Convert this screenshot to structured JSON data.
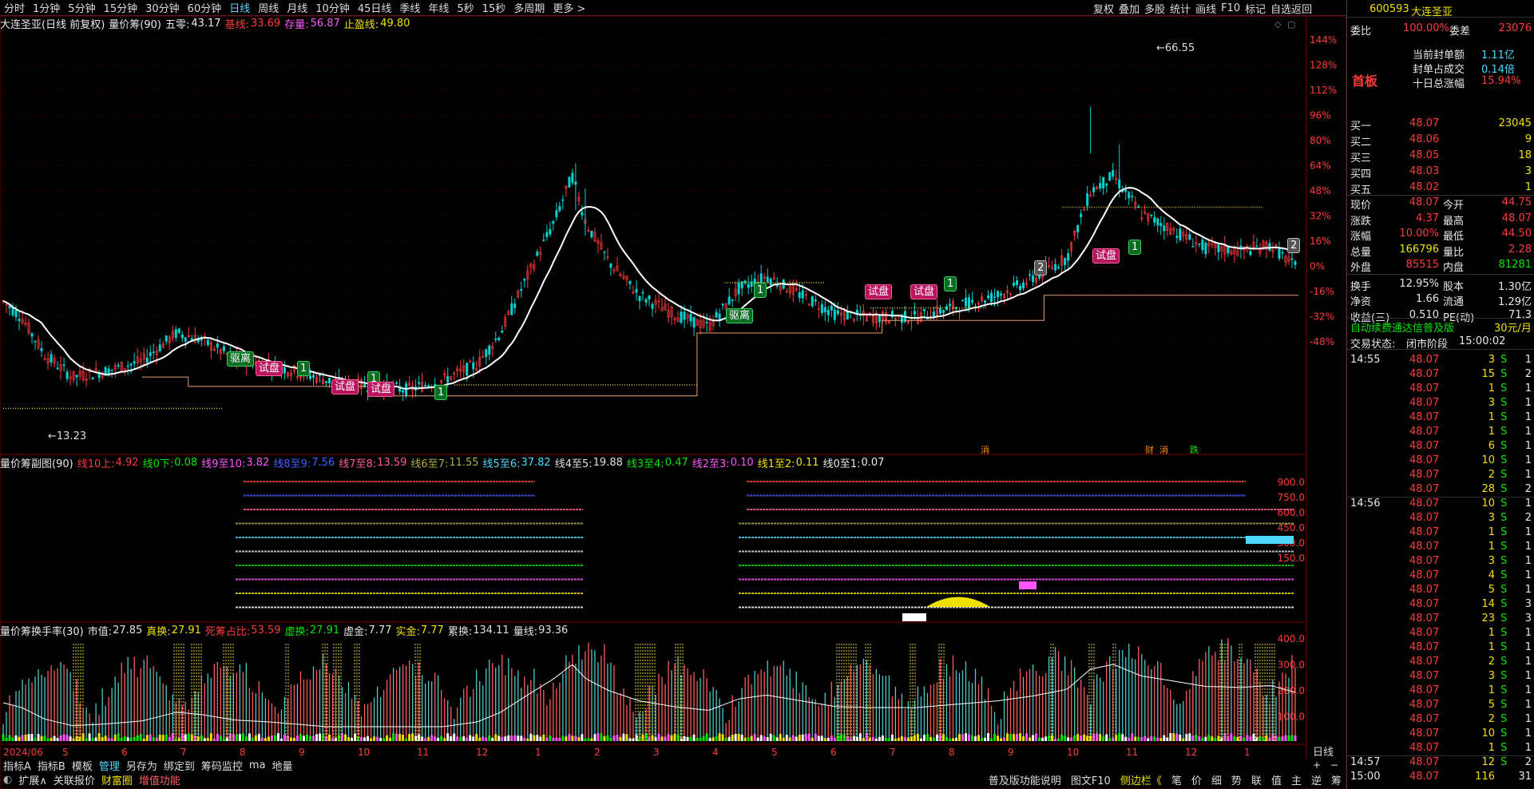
{
  "toolbar": {
    "left": [
      "分时",
      "1分钟",
      "5分钟",
      "15分钟",
      "30分钟",
      "60分钟",
      "日线",
      "周线",
      "月线",
      "10分钟",
      "45日线",
      "季线",
      "年线",
      "5秒",
      "15秒",
      "多周期",
      "更多 >"
    ],
    "active_index": 6,
    "right": [
      "复权",
      "叠加",
      "多股",
      "统计",
      "画线",
      "F10",
      "标记",
      "自选返回"
    ]
  },
  "main_pane": {
    "title": "大连圣亚(日线 前复权)",
    "indicator": "量价筹(90)",
    "five_zero_label": "五零:",
    "five_zero_value": "43.17",
    "base_label": "基线:",
    "base_value": "33.69",
    "stock_label": "存量:",
    "stock_value": "56.87",
    "stop_label": "止盈线:",
    "stop_value": "49.80",
    "y_ticks": [
      "144%",
      "128%",
      "112%",
      "96%",
      "80%",
      "64%",
      "48%",
      "32%",
      "16%",
      "0%",
      "-16%",
      "-32%",
      "-48%"
    ],
    "high_label": "66.55",
    "low_label": "13.23",
    "tags": [
      {
        "text": "驱离",
        "type": "green"
      },
      {
        "text": "试盘",
        "type": "pink"
      },
      {
        "text": "1",
        "type": "green"
      },
      {
        "text": "试盘",
        "type": "pink"
      },
      {
        "text": "1",
        "type": "green"
      },
      {
        "text": "试盘",
        "type": "pink"
      },
      {
        "text": "1",
        "type": "green"
      },
      {
        "text": "驱离",
        "type": "green"
      },
      {
        "text": "1",
        "type": "green"
      },
      {
        "text": "试盘",
        "type": "pink"
      },
      {
        "text": "试盘",
        "type": "pink"
      },
      {
        "text": "1",
        "type": "green"
      },
      {
        "text": "2",
        "type": "grey"
      },
      {
        "text": "试盘",
        "type": "pink"
      },
      {
        "text": "1",
        "type": "green"
      },
      {
        "text": "2",
        "type": "grey"
      }
    ],
    "event_marks": [
      "消",
      "财",
      "消",
      "跌"
    ]
  },
  "sub_pane": {
    "title": "量价筹副图(90)",
    "lines": [
      {
        "label": "线10上:",
        "value": "4.92",
        "color": "#ff3b3b"
      },
      {
        "label": "线0下:",
        "value": "0.08",
        "color": "#00e600"
      },
      {
        "label": "线9至10:",
        "value": "3.82",
        "color": "#ff55ff"
      },
      {
        "label": "线8至9:",
        "value": "7.56",
        "color": "#4060ff"
      },
      {
        "label": "线7至8:",
        "value": "13.59",
        "color": "#ff5c9a"
      },
      {
        "label": "线6至7:",
        "value": "11.55",
        "color": "#b0b040"
      },
      {
        "label": "线5至6:",
        "value": "37.82",
        "color": "#4fd8ff"
      },
      {
        "label": "线4至5:",
        "value": "19.88",
        "color": "#e0e0e0"
      },
      {
        "label": "线3至4:",
        "value": "0.47",
        "color": "#00e600"
      },
      {
        "label": "线2至3:",
        "value": "0.10",
        "color": "#ff55ff"
      },
      {
        "label": "线1至2:",
        "value": "0.11",
        "color": "#f0e000"
      },
      {
        "label": "线0至1:",
        "value": "0.07",
        "color": "#e8e8e8"
      }
    ],
    "y_ticks": [
      "900.0",
      "750.0",
      "600.0",
      "450.0",
      "300.0",
      "150.0"
    ]
  },
  "turnover_pane": {
    "title": "量价筹换手率(30)",
    "items": [
      {
        "label": "市值:",
        "value": "27.85",
        "color": "#e0e0e0"
      },
      {
        "label": "真换:",
        "value": "27.91",
        "color": "#f0e000"
      },
      {
        "label": "死筹占比:",
        "value": "53.59",
        "color": "#ff3b3b"
      },
      {
        "label": "虚换:",
        "value": "27.91",
        "color": "#00e600"
      },
      {
        "label": "虚金:",
        "value": "7.77",
        "color": "#e0e0e0"
      },
      {
        "label": "实金:",
        "value": "7.77",
        "color": "#f0e000"
      },
      {
        "label": "累换:",
        "value": "134.11",
        "color": "#e0e0e0"
      },
      {
        "label": "量线:",
        "value": "93.36",
        "color": "#e0e0e0"
      }
    ],
    "y_ticks": [
      "400.0",
      "300.0",
      "200.0",
      "100.0"
    ]
  },
  "x_axis": [
    "2024/06",
    "5",
    "6",
    "7",
    "8",
    "9",
    "10",
    "11",
    "12",
    "1",
    "2",
    "3",
    "4",
    "5",
    "6",
    "7",
    "8",
    "9",
    "10",
    "11",
    "12",
    "1"
  ],
  "period_label": "日线",
  "bottom_row1": [
    "指标A",
    "指标B",
    "模板",
    "管理",
    "另存为",
    "绑定到",
    "筹码监控",
    "ma",
    "地量"
  ],
  "bottom_row2_left": [
    "扩展∧",
    "关联报价",
    "财富圈",
    "增值功能"
  ],
  "bottom_row2_right": [
    "普及版功能说明",
    "图文F10",
    "侧边栏《",
    "笔",
    "价",
    "细",
    "势",
    "联",
    "值",
    "主",
    "逆",
    "筹"
  ],
  "quote": {
    "code": "600593",
    "name": "大连圣亚",
    "weibi_label": "委比",
    "weibi_value": "100.00%",
    "weicha_label": "委差",
    "weicha_value": "23076",
    "first_board": "首板",
    "seal_amount_label": "当前封单额",
    "seal_amount_value": "1.11亿",
    "seal_ratio_label": "封单占成交",
    "seal_ratio_value": "0.14倍",
    "ten_day_label": "十日总涨幅",
    "ten_day_value": "15.94%",
    "bids": [
      {
        "label": "买一",
        "price": "48.07",
        "vol": "23045"
      },
      {
        "label": "买二",
        "price": "48.06",
        "vol": "9"
      },
      {
        "label": "买三",
        "price": "48.05",
        "vol": "18"
      },
      {
        "label": "买四",
        "price": "48.03",
        "vol": "3"
      },
      {
        "label": "买五",
        "price": "48.02",
        "vol": "1"
      }
    ],
    "stats": [
      {
        "l1": "现价",
        "v1": "48.07",
        "c1": "red",
        "l2": "今开",
        "v2": "44.75",
        "c2": "red"
      },
      {
        "l1": "涨跌",
        "v1": "4.37",
        "c1": "red",
        "l2": "最高",
        "v2": "48.07",
        "c2": "red"
      },
      {
        "l1": "涨幅",
        "v1": "10.00%",
        "c1": "red",
        "l2": "最低",
        "v2": "44.50",
        "c2": "red"
      },
      {
        "l1": "总量",
        "v1": "166796",
        "c1": "yel",
        "l2": "量比",
        "v2": "2.28",
        "c2": "red"
      },
      {
        "l1": "外盘",
        "v1": "85515",
        "c1": "red",
        "l2": "内盘",
        "v2": "81281",
        "c2": "grn"
      },
      {
        "l1": "换手",
        "v1": "12.95%",
        "c1": "wht",
        "l2": "股本",
        "v2": "1.30亿",
        "c2": "wht"
      },
      {
        "l1": "净资",
        "v1": "1.66",
        "c1": "wht",
        "l2": "流通",
        "v2": "1.29亿",
        "c2": "wht"
      },
      {
        "l1": "收益(三)",
        "v1": "0.510",
        "c1": "wht",
        "l2": "PE(动)",
        "v2": "71.3",
        "c2": "wht"
      }
    ],
    "promo": "自动续费通达信普及版",
    "promo_price": "30元/月",
    "trade_state_label": "交易状态:",
    "trade_state_value": "闭市阶段",
    "trade_time": "15:00:02",
    "ticks": [
      {
        "t": "14:55",
        "p": "48.07",
        "v": "3",
        "s": "S",
        "n": "1"
      },
      {
        "t": "",
        "p": "48.07",
        "v": "15",
        "s": "S",
        "n": "2"
      },
      {
        "t": "",
        "p": "48.07",
        "v": "1",
        "s": "S",
        "n": "1"
      },
      {
        "t": "",
        "p": "48.07",
        "v": "3",
        "s": "S",
        "n": "1"
      },
      {
        "t": "",
        "p": "48.07",
        "v": "1",
        "s": "S",
        "n": "1"
      },
      {
        "t": "",
        "p": "48.07",
        "v": "1",
        "s": "S",
        "n": "1"
      },
      {
        "t": "",
        "p": "48.07",
        "v": "6",
        "s": "S",
        "n": "1"
      },
      {
        "t": "",
        "p": "48.07",
        "v": "10",
        "s": "S",
        "n": "1"
      },
      {
        "t": "",
        "p": "48.07",
        "v": "2",
        "s": "S",
        "n": "1"
      },
      {
        "t": "",
        "p": "48.07",
        "v": "28",
        "s": "S",
        "n": "2"
      },
      {
        "t": "14:56",
        "p": "48.07",
        "v": "10",
        "s": "S",
        "n": "1"
      },
      {
        "t": "",
        "p": "48.07",
        "v": "3",
        "s": "S",
        "n": "2"
      },
      {
        "t": "",
        "p": "48.07",
        "v": "1",
        "s": "S",
        "n": "1"
      },
      {
        "t": "",
        "p": "48.07",
        "v": "1",
        "s": "S",
        "n": "1"
      },
      {
        "t": "",
        "p": "48.07",
        "v": "3",
        "s": "S",
        "n": "1"
      },
      {
        "t": "",
        "p": "48.07",
        "v": "4",
        "s": "S",
        "n": "1"
      },
      {
        "t": "",
        "p": "48.07",
        "v": "5",
        "s": "S",
        "n": "1"
      },
      {
        "t": "",
        "p": "48.07",
        "v": "14",
        "s": "S",
        "n": "3"
      },
      {
        "t": "",
        "p": "48.07",
        "v": "23",
        "s": "S",
        "n": "3"
      },
      {
        "t": "",
        "p": "48.07",
        "v": "1",
        "s": "S",
        "n": "1"
      },
      {
        "t": "",
        "p": "48.07",
        "v": "1",
        "s": "S",
        "n": "1"
      },
      {
        "t": "",
        "p": "48.07",
        "v": "2",
        "s": "S",
        "n": "1"
      },
      {
        "t": "",
        "p": "48.07",
        "v": "3",
        "s": "S",
        "n": "1"
      },
      {
        "t": "",
        "p": "48.07",
        "v": "1",
        "s": "S",
        "n": "1"
      },
      {
        "t": "",
        "p": "48.07",
        "v": "5",
        "s": "S",
        "n": "1"
      },
      {
        "t": "",
        "p": "48.07",
        "v": "2",
        "s": "S",
        "n": "1"
      },
      {
        "t": "",
        "p": "48.07",
        "v": "10",
        "s": "S",
        "n": "1"
      },
      {
        "t": "",
        "p": "48.07",
        "v": "1",
        "s": "S",
        "n": "1"
      },
      {
        "t": "14:57",
        "p": "48.07",
        "v": "12",
        "s": "S",
        "n": "2"
      },
      {
        "t": "15:00",
        "p": "48.07",
        "v": "116",
        "s": "",
        "n": "31"
      }
    ]
  }
}
